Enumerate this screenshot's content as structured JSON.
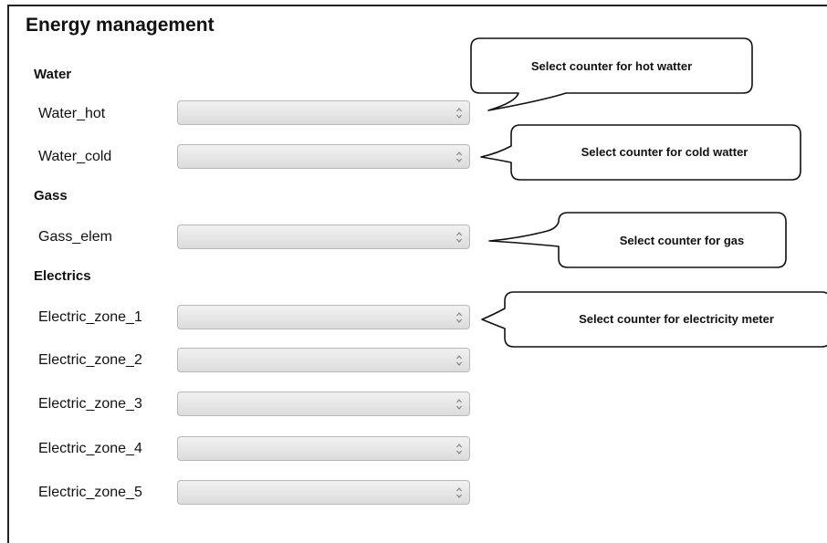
{
  "page": {
    "title": "Energy management"
  },
  "sections": [
    {
      "title": "Water",
      "rows": [
        {
          "label": "Water_hot",
          "value": ""
        },
        {
          "label": "Water_cold",
          "value": ""
        }
      ]
    },
    {
      "title": "Gass",
      "rows": [
        {
          "label": "Gass_elem",
          "value": ""
        }
      ]
    },
    {
      "title": "Electrics",
      "rows": [
        {
          "label": "Electric_zone_1",
          "value": ""
        },
        {
          "label": "Electric_zone_2",
          "value": ""
        },
        {
          "label": "Electric_zone_3",
          "value": ""
        },
        {
          "label": "Electric_zone_4",
          "value": ""
        },
        {
          "label": "Electric_zone_5",
          "value": ""
        }
      ]
    }
  ],
  "callouts": {
    "hot_water": "Select  counter for hot watter",
    "cold_water": "Select  counter for cold watter",
    "gas": "Select  counter for gas",
    "electricity": "Select  counter for electricity meter"
  },
  "icons": {
    "select_arrow": "up-down-stepper-icon"
  }
}
